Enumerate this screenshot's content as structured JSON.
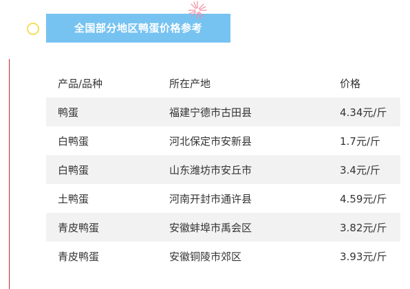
{
  "header": {
    "title": "全国部分地区鸭蛋价格参考"
  },
  "table": {
    "columns": [
      "产品/品种",
      "所在产地",
      "价格"
    ],
    "rows": [
      {
        "product": "鸭蛋",
        "origin": "福建宁德市古田县",
        "price": "4.34元/斤"
      },
      {
        "product": "白鸭蛋",
        "origin": "河北保定市安新县",
        "price": "1.7元/斤"
      },
      {
        "product": "白鸭蛋",
        "origin": "山东潍坊市安丘市",
        "price": "3.4元/斤"
      },
      {
        "product": "土鸭蛋",
        "origin": "河南开封市通许县",
        "price": "4.59元/斤"
      },
      {
        "product": "青皮鸭蛋",
        "origin": "安徽蚌埠市禹会区",
        "price": "3.82元/斤"
      },
      {
        "product": "青皮鸭蛋",
        "origin": "安徽铜陵市郊区",
        "price": "3.93元/斤"
      }
    ]
  },
  "colors": {
    "title_background": "#76c3f2",
    "title_text": "#ffffff",
    "accent_rule": "#c61f2c",
    "circle_decoration": "#f3de5c",
    "row_stripe": "#f2f2f2",
    "body_text": "#333333"
  }
}
